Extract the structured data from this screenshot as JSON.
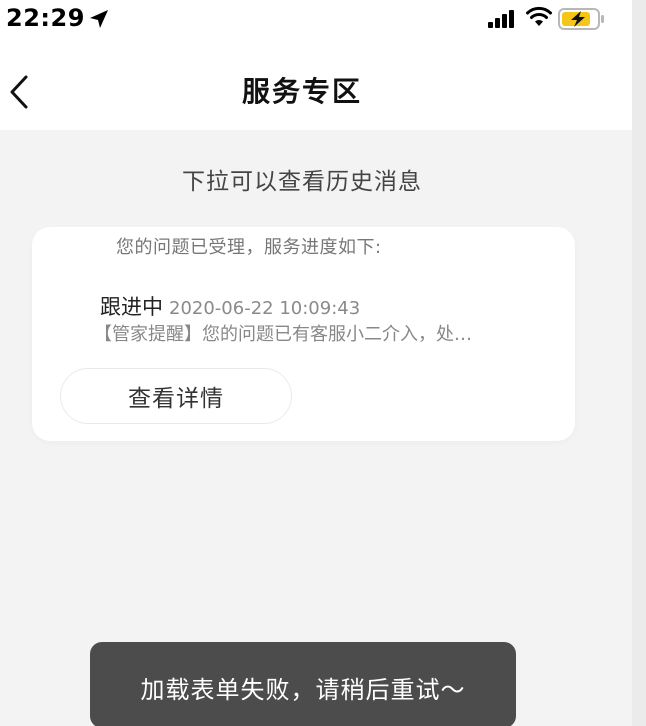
{
  "status_bar": {
    "time": "22:29",
    "icons": [
      "location-arrow-icon",
      "cellular-signal-icon",
      "wifi-icon",
      "battery-charging-icon"
    ],
    "battery_color": "#f5c518"
  },
  "nav": {
    "title": "服务专区",
    "back_icon": "chevron-left-icon"
  },
  "pull_hint": "下拉可以查看历史消息",
  "card": {
    "intro": "您的问题已受理，服务进度如下:",
    "status_label": "跟进中",
    "status_time": "2020-06-22 10:09:43",
    "notice": "【管家提醒】您的问题已有客服小二介入，处…",
    "detail_button_label": "查看详情"
  },
  "toast": {
    "message": "加载表单失败，请稍后重试～"
  }
}
